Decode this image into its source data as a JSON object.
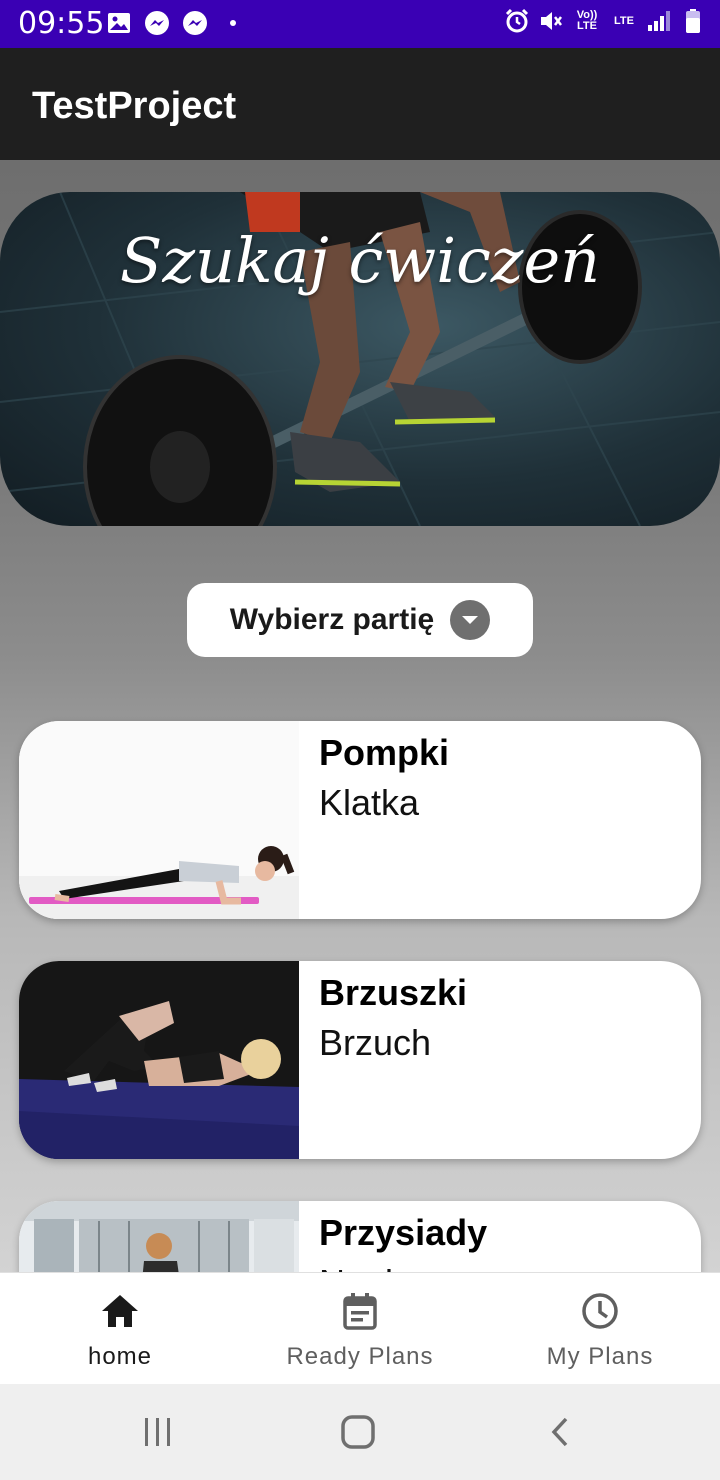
{
  "status_bar": {
    "time": "09:55",
    "volte": "Vo)) LTE",
    "lte": "LTE",
    "left_icons": [
      "image-icon",
      "messenger-icon",
      "messenger-icon",
      "dot-icon"
    ],
    "right_icons": [
      "alarm-icon",
      "mute-icon",
      "volte-icon",
      "lte-icon",
      "signal-icon",
      "battery-icon"
    ]
  },
  "app_bar": {
    "title": "TestProject"
  },
  "hero": {
    "title": "Szukaj ćwiczeń"
  },
  "filter": {
    "label": "Wybierz partię"
  },
  "exercises": [
    {
      "name": "Pompki",
      "part": "Klatka"
    },
    {
      "name": "Brzuszki",
      "part": "Brzuch"
    },
    {
      "name": "Przysiady",
      "part": "Nogi"
    }
  ],
  "bottom_nav": {
    "items": [
      {
        "label": "home",
        "icon": "home-icon",
        "active": true
      },
      {
        "label": "Ready Plans",
        "icon": "calendar-icon",
        "active": false
      },
      {
        "label": "My Plans",
        "icon": "clock-icon",
        "active": false
      }
    ]
  },
  "colors": {
    "status_bar": "#3a00b4",
    "app_bar": "#1f1f1f",
    "active_nav": "#1a1a1a",
    "inactive_nav": "#5f5f5f"
  }
}
